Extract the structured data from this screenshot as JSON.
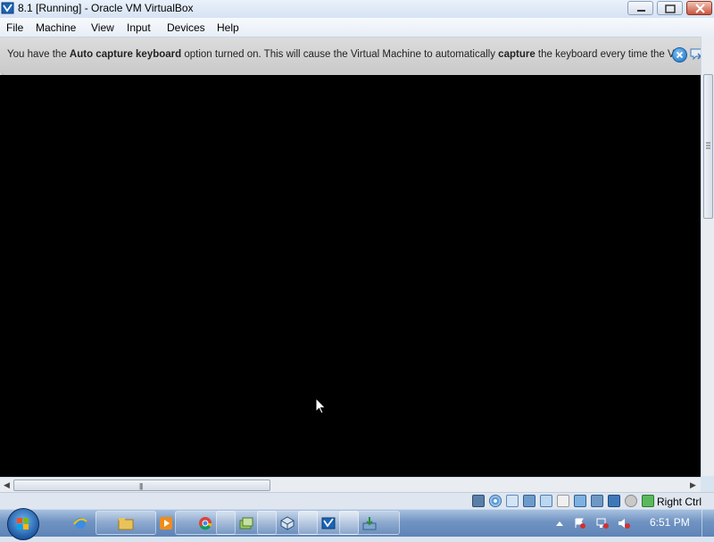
{
  "window": {
    "title": "8.1 [Running] - Oracle VM VirtualBox",
    "icon": "virtualbox-icon"
  },
  "menu": {
    "items": [
      "File",
      "Machine",
      "View",
      "Input",
      "Devices",
      "Help"
    ]
  },
  "notice": {
    "part1": "You have the ",
    "bold1": "Auto capture keyboard",
    "part2": " option turned on. This will cause the Virtual Machine to automatically ",
    "bold2": "capture",
    "part3": " the keyboard every time the VM"
  },
  "statusbar": {
    "host_key": "Right Ctrl",
    "icons": [
      "hard-disk-icon",
      "optical-drive-icon",
      "audio-icon",
      "network-icon",
      "usb-icon",
      "shared-folders-icon",
      "display-icon",
      "video-capture-icon",
      "virtualization-icon",
      "mouse-integration-icon",
      "keyboard-capture-icon"
    ]
  },
  "taskbar": {
    "apps": [
      "internet-explorer-icon",
      "file-explorer-icon",
      "media-player-icon",
      "chrome-icon",
      "network-folder-icon",
      "virtualbox-manager-icon",
      "virtualbox-vm-icon",
      "downloads-icon"
    ],
    "clock": "6:51 PM"
  }
}
